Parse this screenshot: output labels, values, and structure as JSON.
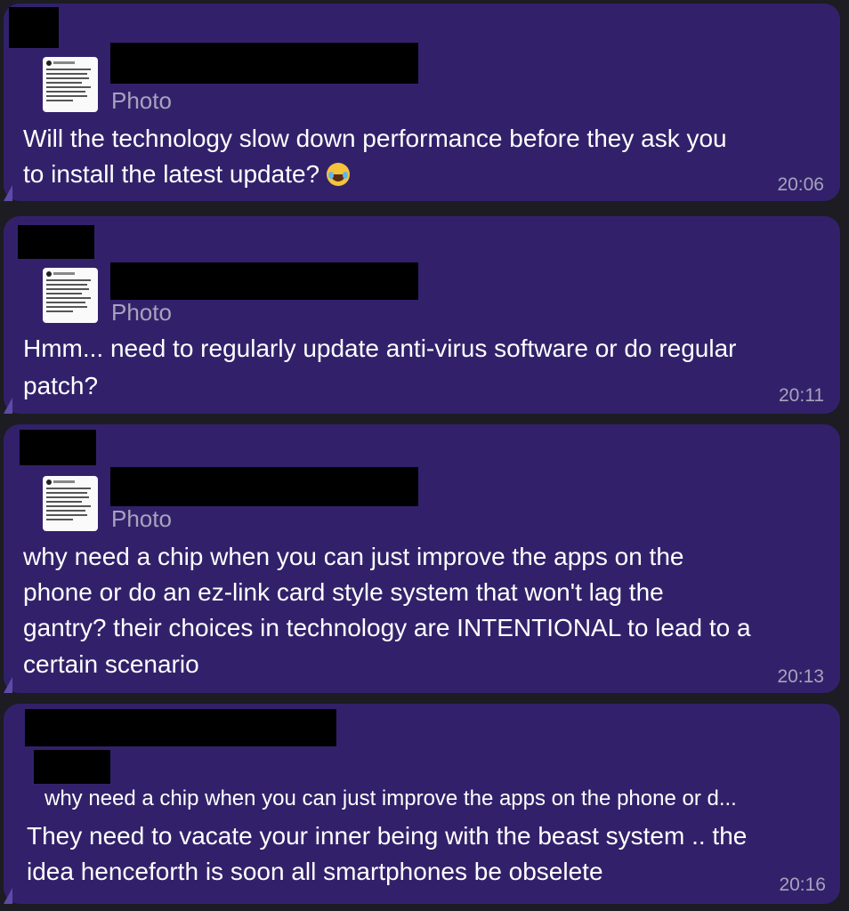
{
  "messages": [
    {
      "photo_label": "Photo",
      "text_lines": [
        "Will the technology slow down performance before they ask you",
        "to install the latest update?"
      ],
      "emoji": "face-with-tears-of-joy",
      "time": "20:06"
    },
    {
      "photo_label": "Photo",
      "text_lines": [
        "Hmm... need to regularly update anti-virus software or do regular",
        "patch?"
      ],
      "time": "20:11"
    },
    {
      "photo_label": "Photo",
      "text_lines": [
        "why need a chip when you can just improve the apps on the",
        "phone or do an ez-link card style system that won't lag the",
        "gantry? their choices in technology are INTENTIONAL to lead to a",
        "certain scenario"
      ],
      "time": "20:13"
    },
    {
      "reply_preview": "why need a chip when you can just improve the apps on the phone or d...",
      "text_lines": [
        "They need to vacate your inner being with the beast system .. the",
        "idea henceforth is soon all smartphones be obselete"
      ],
      "time": "20:16"
    }
  ],
  "colors": {
    "bubble": "#32216a",
    "secondary_text": "#a8a2bd",
    "redaction": "#000000"
  }
}
